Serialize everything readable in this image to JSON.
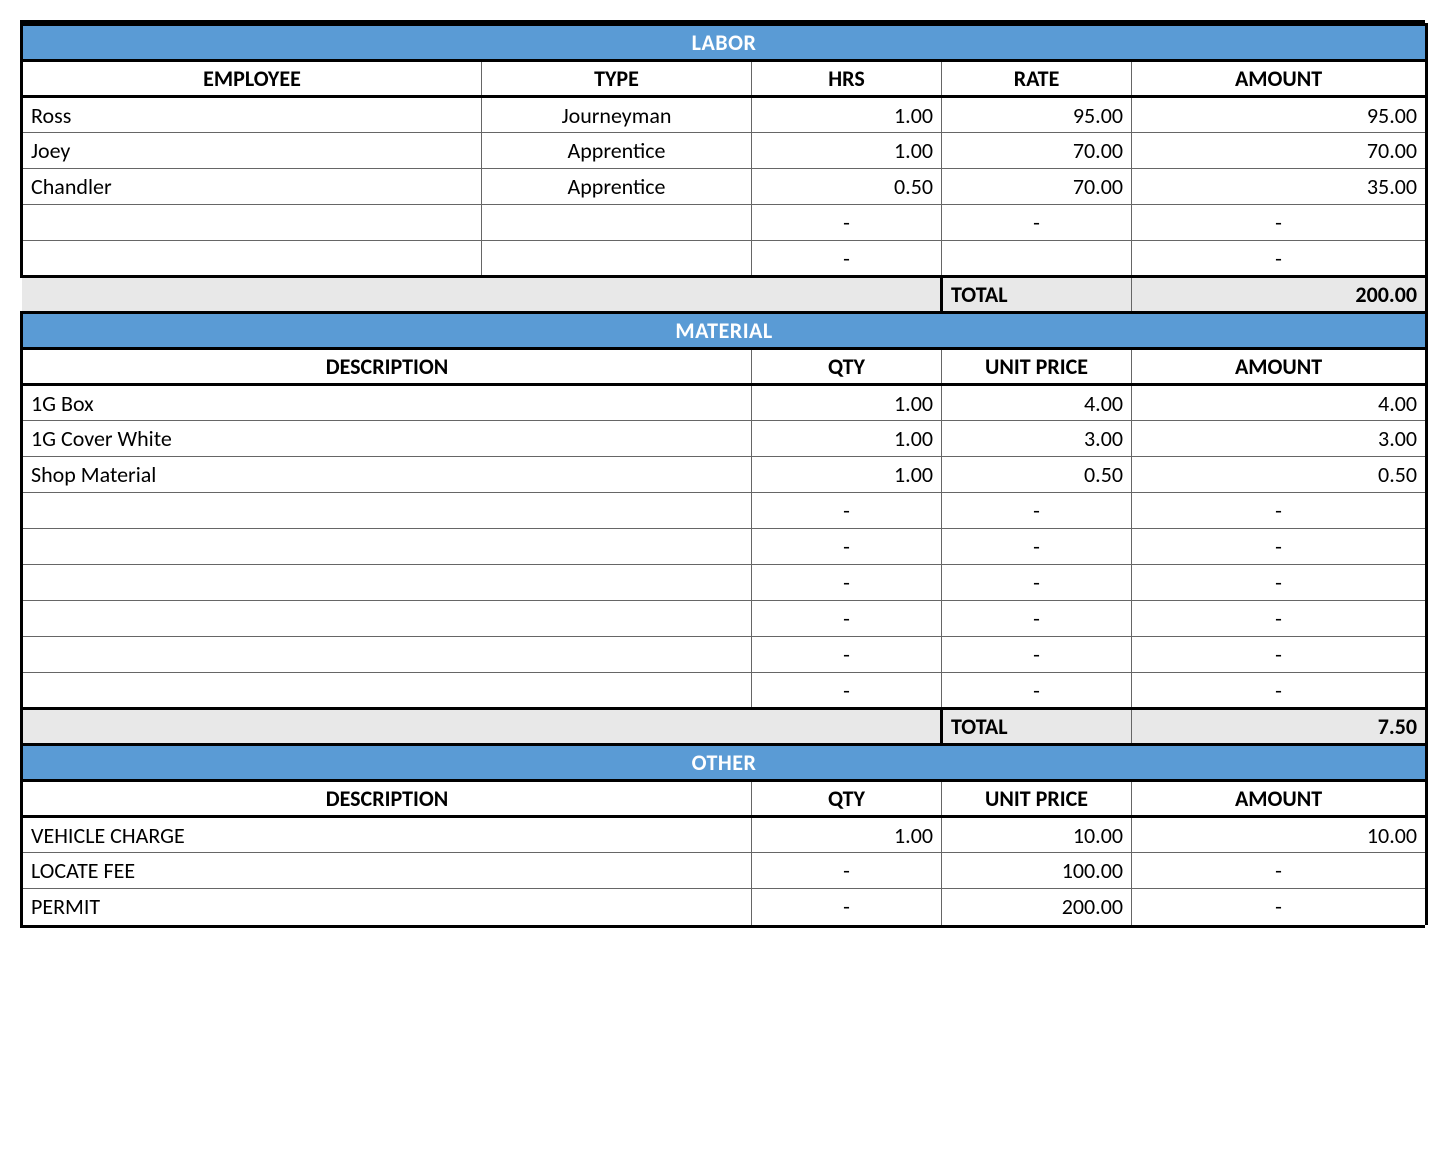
{
  "colors": {
    "section_bg": "#5a9bd5",
    "total_bg": "#e8e8e8"
  },
  "labor": {
    "title": "LABOR",
    "headers": {
      "employee": "EMPLOYEE",
      "type": "TYPE",
      "hrs": "HRS",
      "rate": "RATE",
      "amount": "AMOUNT"
    },
    "rows": [
      {
        "employee": "Ross",
        "type": "Journeyman",
        "hrs": "1.00",
        "rate": "95.00",
        "amount": "95.00"
      },
      {
        "employee": "Joey",
        "type": "Apprentice",
        "hrs": "1.00",
        "rate": "70.00",
        "amount": "70.00"
      },
      {
        "employee": "Chandler",
        "type": "Apprentice",
        "hrs": "0.50",
        "rate": "70.00",
        "amount": "35.00"
      },
      {
        "employee": "",
        "type": "",
        "hrs": "-",
        "rate": "-",
        "amount": "-"
      },
      {
        "employee": "",
        "type": "",
        "hrs": "-",
        "rate": "",
        "amount": "-"
      }
    ],
    "total_label": "TOTAL",
    "total": "200.00"
  },
  "material": {
    "title": "MATERIAL",
    "headers": {
      "description": "DESCRIPTION",
      "qty": "QTY",
      "unit_price": "UNIT PRICE",
      "amount": "AMOUNT"
    },
    "rows": [
      {
        "description": "1G Box",
        "qty": "1.00",
        "unit_price": "4.00",
        "amount": "4.00"
      },
      {
        "description": "1G Cover White",
        "qty": "1.00",
        "unit_price": "3.00",
        "amount": "3.00"
      },
      {
        "description": "Shop Material",
        "qty": "1.00",
        "unit_price": "0.50",
        "amount": "0.50"
      },
      {
        "description": "",
        "qty": "-",
        "unit_price": "-",
        "amount": "-"
      },
      {
        "description": "",
        "qty": "-",
        "unit_price": "-",
        "amount": "-"
      },
      {
        "description": "",
        "qty": "-",
        "unit_price": "-",
        "amount": "-"
      },
      {
        "description": "",
        "qty": "-",
        "unit_price": "-",
        "amount": "-"
      },
      {
        "description": "",
        "qty": "-",
        "unit_price": "-",
        "amount": "-"
      },
      {
        "description": "",
        "qty": "-",
        "unit_price": "-",
        "amount": "-"
      }
    ],
    "total_label": "TOTAL",
    "total": "7.50"
  },
  "other": {
    "title": "OTHER",
    "headers": {
      "description": "DESCRIPTION",
      "qty": "QTY",
      "unit_price": "UNIT PRICE",
      "amount": "AMOUNT"
    },
    "rows": [
      {
        "description": "VEHICLE CHARGE",
        "qty": "1.00",
        "unit_price": "10.00",
        "amount": "10.00"
      },
      {
        "description": "LOCATE FEE",
        "qty": "-",
        "unit_price": "100.00",
        "amount": "-"
      },
      {
        "description": "PERMIT",
        "qty": "-",
        "unit_price": "200.00",
        "amount": "-"
      }
    ]
  }
}
